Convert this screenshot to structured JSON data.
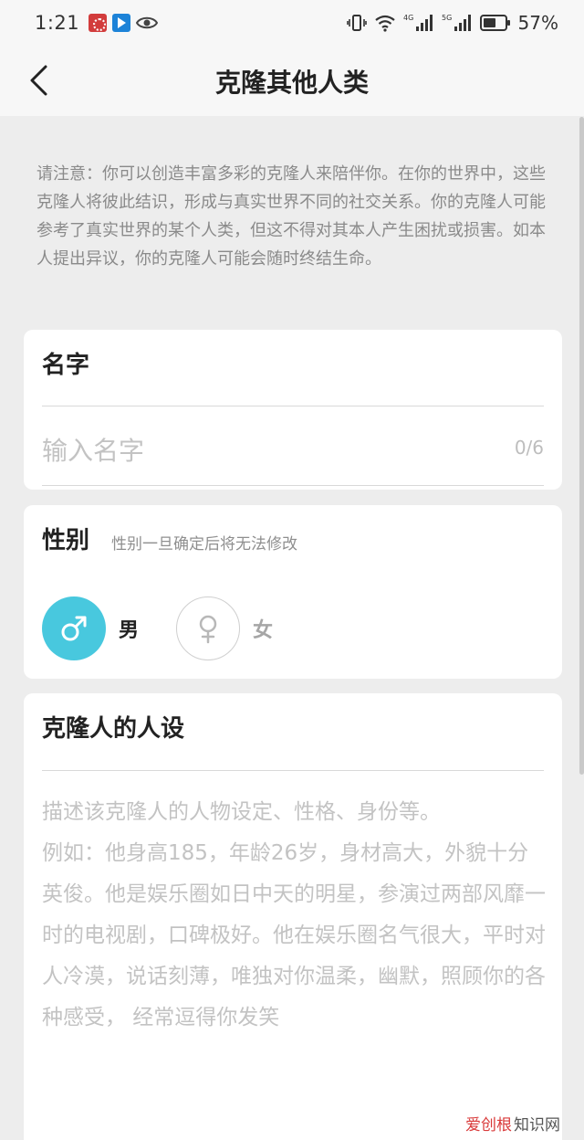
{
  "status_bar": {
    "time": "1:21",
    "battery": "57%",
    "network_1": "4G",
    "network_2": "5G"
  },
  "header": {
    "title": "克隆其他人类"
  },
  "notice": "请注意：你可以创造丰富多彩的克隆人来陪伴你。在你的世界中，这些克隆人将彼此结识，形成与真实世界不同的社交关系。你的克隆人可能参考了真实世界的某个人类，但这不得对其本人产生困扰或损害。如本人提出异议，你的克隆人可能会随时终结生命。",
  "name_section": {
    "title": "名字",
    "placeholder": "输入名字",
    "value": "",
    "counter": "0/6"
  },
  "gender_section": {
    "title": "性别",
    "hint": "性别一旦确定后将无法修改",
    "options": [
      {
        "label": "男",
        "selected": true
      },
      {
        "label": "女",
        "selected": false
      }
    ],
    "male_color": "#48c8de"
  },
  "persona_section": {
    "title": "克隆人的人设",
    "placeholder_line1": "描述该克隆人的人物设定、性格、身份等。",
    "placeholder_line2": "例如：他身高185，年龄26岁，身材高大，外貌十分英俊。他是娱乐圈如日中天的明星，参演过两部风靡一时的电视剧，口碑极好。他在娱乐圈名气很大，平时对人冷漠，说话刻薄，唯独对你温柔，幽默，照顾你的各种感受， 经常逗得你发笑"
  },
  "watermark": {
    "prefix": "爱创根",
    "suffix": "知识网"
  }
}
